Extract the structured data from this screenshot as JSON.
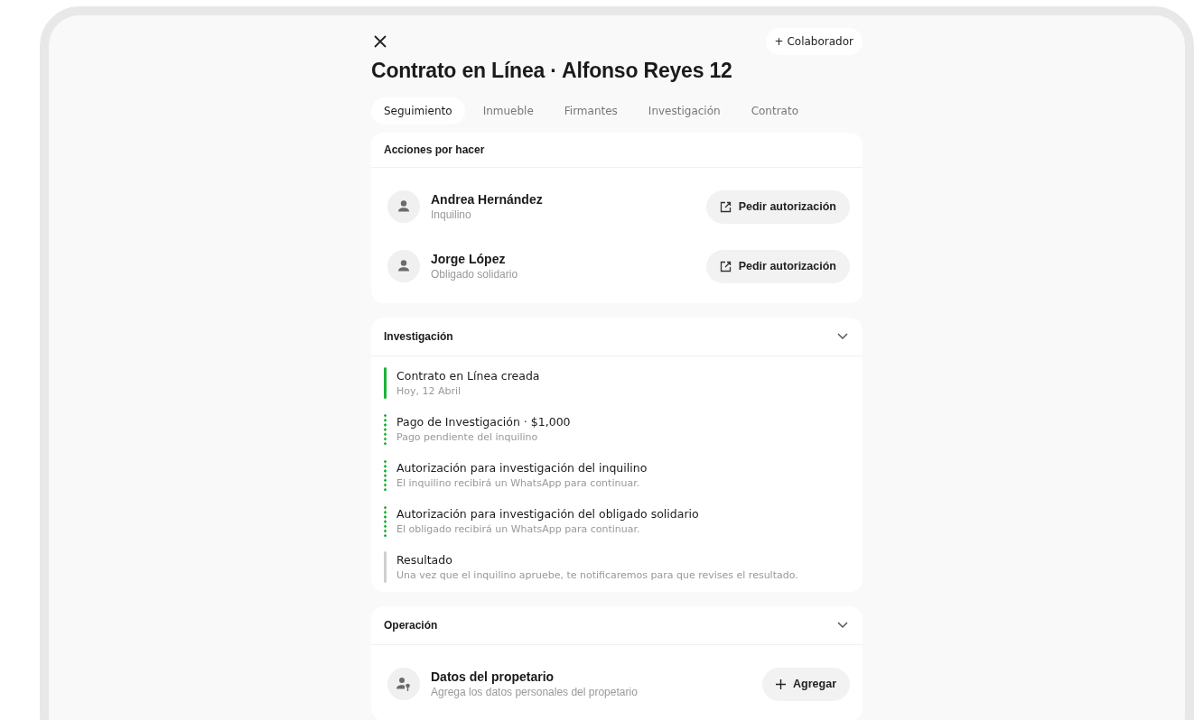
{
  "header": {
    "collaborator_button": "+ Colaborador",
    "title": "Contrato en Línea · Alfonso Reyes 12"
  },
  "tabs": [
    {
      "label": "Seguimiento",
      "selected": true
    },
    {
      "label": "Inmueble",
      "selected": false
    },
    {
      "label": "Firmantes",
      "selected": false
    },
    {
      "label": "Investigación",
      "selected": false
    },
    {
      "label": "Contrato",
      "selected": false
    }
  ],
  "actions": {
    "title": "Acciones por hacer",
    "rows": [
      {
        "name": "Andrea Hernández",
        "role": "Inquilino",
        "button": "Pedir autorización"
      },
      {
        "name": "Jorge López",
        "role": "Obligado solidario",
        "button": "Pedir autorización"
      }
    ]
  },
  "investigation": {
    "title": "Investigación",
    "steps": [
      {
        "title": "Contrato en Línea creada",
        "detail": "Hoy, 12 Abril",
        "kind": "done"
      },
      {
        "title": "Pago de Investigación · $1,000",
        "detail": "Pago pendiente del inquilino",
        "kind": "pending"
      },
      {
        "title": "Autorización para investigación del inquilino",
        "detail": "El inquilino recibirá un WhatsApp para continuar.",
        "kind": "pending"
      },
      {
        "title": "Autorización para investigación del obligado solidario",
        "detail": "El obligado recibirá un WhatsApp para continuar.",
        "kind": "pending"
      },
      {
        "title": "Resultado",
        "detail": "Una vez que el inquilino apruebe, te notificaremos para que revises el resultado.",
        "kind": "upcoming"
      }
    ]
  },
  "operation": {
    "title": "Operación",
    "rows": [
      {
        "title": "Datos del propetario",
        "detail": "Agrega los datos personales del propetario",
        "button": "Agregar"
      }
    ]
  }
}
